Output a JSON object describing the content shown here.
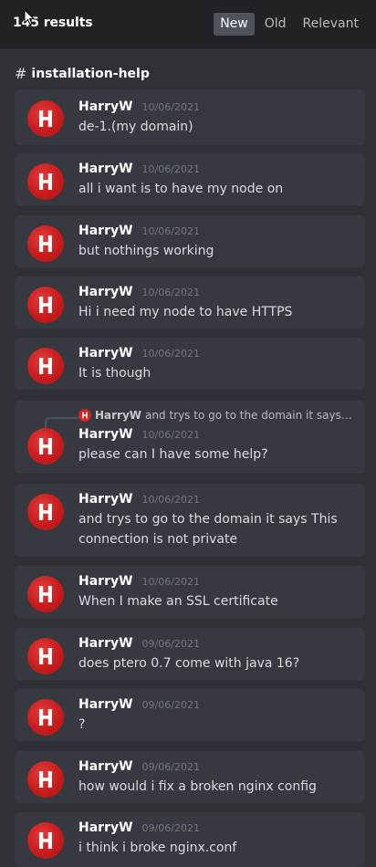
{
  "header": {
    "results_count": "145 results",
    "sort_options": [
      {
        "label": "New",
        "active": true
      },
      {
        "label": "Old",
        "active": false
      },
      {
        "label": "Relevant",
        "active": false
      }
    ]
  },
  "channel": {
    "name": "installation-help"
  },
  "colors": {
    "background": "#2f3136",
    "card": "#36393f",
    "header": "#202225",
    "avatar_red": "#d42121",
    "active_tab": "#4f545c"
  },
  "messages": [
    {
      "username": "HarryW",
      "timestamp": "10/06/2021",
      "text": "de-1.(my domain)"
    },
    {
      "username": "HarryW",
      "timestamp": "10/06/2021",
      "text": "all i want is to have my node on"
    },
    {
      "username": "HarryW",
      "timestamp": "10/06/2021",
      "text": "but nothings working"
    },
    {
      "username": "HarryW",
      "timestamp": "10/06/2021",
      "text": "Hi i need my node to have HTTPS"
    },
    {
      "username": "HarryW",
      "timestamp": "10/06/2021",
      "text": "It is though"
    },
    {
      "username": "HarryW",
      "timestamp": "10/06/2021",
      "text": "please can I have some help?",
      "reply_to": {
        "username": "HarryW",
        "snippet": "and trys to go to the domain it says T…"
      }
    },
    {
      "username": "HarryW",
      "timestamp": "10/06/2021",
      "text": "and trys to go to the domain it says This connection is not private"
    },
    {
      "username": "HarryW",
      "timestamp": "10/06/2021",
      "text": "When I make an SSL certificate"
    },
    {
      "username": "HarryW",
      "timestamp": "09/06/2021",
      "text": "does ptero 0.7 come with java 16?"
    },
    {
      "username": "HarryW",
      "timestamp": "09/06/2021",
      "text": "?"
    },
    {
      "username": "HarryW",
      "timestamp": "09/06/2021",
      "text": "how would i fix a broken nginx config"
    },
    {
      "username": "HarryW",
      "timestamp": "09/06/2021",
      "text": "i think i broke nginx.conf"
    }
  ]
}
